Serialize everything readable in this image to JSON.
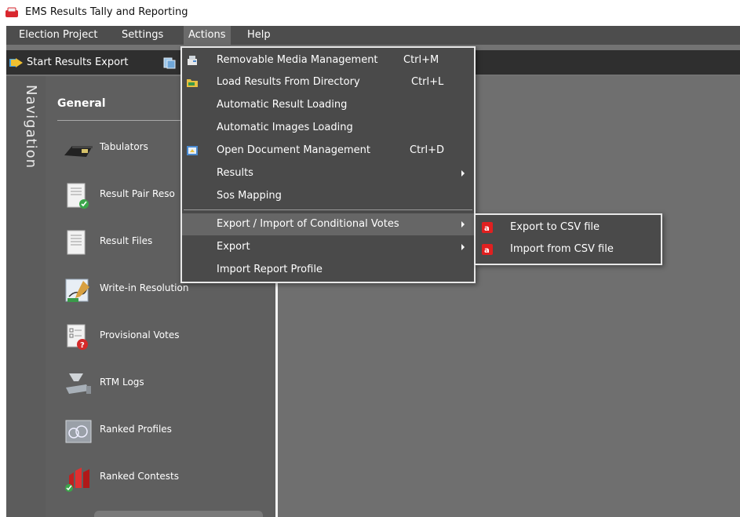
{
  "window": {
    "title": "EMS Results Tally and Reporting"
  },
  "menubar": {
    "items": [
      {
        "label": "Election Project"
      },
      {
        "label": "Settings"
      },
      {
        "label": "Actions"
      },
      {
        "label": "Help"
      }
    ]
  },
  "toolbar": {
    "start_export": "Start Results Export"
  },
  "navigation": {
    "rail_title": "Navigation",
    "section": "General",
    "items": [
      {
        "label": "Tabulators",
        "icon": "tabulator-icon"
      },
      {
        "label": "Result Pair Reso",
        "icon": "result-pair-icon"
      },
      {
        "label": "Result Files",
        "icon": "result-files-icon"
      },
      {
        "label": "Write-in Resolution",
        "icon": "write-in-icon"
      },
      {
        "label": "Provisional Votes",
        "icon": "provisional-votes-icon"
      },
      {
        "label": "RTM Logs",
        "icon": "rtm-logs-icon"
      },
      {
        "label": "Ranked Profiles",
        "icon": "ranked-profiles-icon"
      },
      {
        "label": "Ranked Contests",
        "icon": "ranked-contests-icon"
      }
    ]
  },
  "actions_menu": {
    "items": [
      {
        "label": "Removable Media Management",
        "shortcut": "Ctrl+M"
      },
      {
        "label": "Load Results From Directory",
        "shortcut": "Ctrl+L"
      },
      {
        "label": "Automatic Result Loading",
        "shortcut": ""
      },
      {
        "label": "Automatic Images Loading",
        "shortcut": ""
      },
      {
        "label": "Open Document Management",
        "shortcut": "Ctrl+D"
      },
      {
        "label": "Results",
        "shortcut": ""
      },
      {
        "label": "Sos Mapping",
        "shortcut": ""
      },
      {
        "label": "Export / Import of Conditional Votes",
        "shortcut": ""
      },
      {
        "label": "Export",
        "shortcut": ""
      },
      {
        "label": "Import Report Profile",
        "shortcut": ""
      }
    ]
  },
  "conditional_votes_submenu": {
    "items": [
      {
        "label": "Export to CSV file"
      },
      {
        "label": "Import from CSV file"
      }
    ]
  },
  "colors": {
    "accent_red": "#e02020",
    "menu_bg": "#4a4a4a",
    "menu_highlight": "#666666"
  }
}
